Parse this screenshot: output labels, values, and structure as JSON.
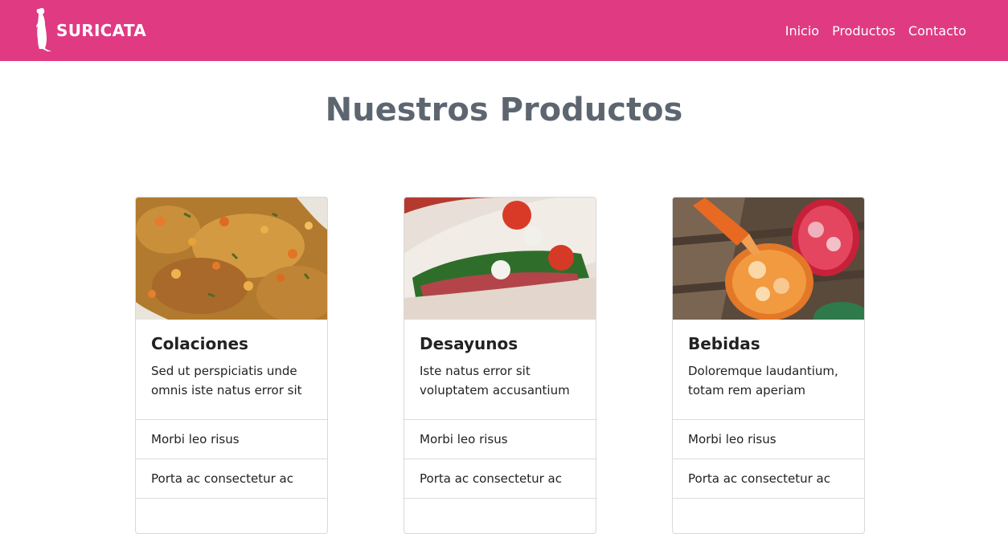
{
  "navbar": {
    "brand_name": "SURICATA",
    "brand_icon": "meerkat-icon",
    "links": [
      "Inicio",
      "Productos",
      "Contacto"
    ],
    "background": "#e03a82"
  },
  "page": {
    "title": "Nuestros Productos"
  },
  "cards": [
    {
      "title": "Colaciones",
      "text": "Sed ut perspiciatis unde omnis iste natus error sit",
      "image": "food-stew-image",
      "items": [
        "Morbi leo risus",
        "Porta ac consectetur ac",
        ""
      ]
    },
    {
      "title": "Desayunos",
      "text": "Iste natus error sit voluptatem accusantium",
      "image": "sandwich-image",
      "items": [
        "Morbi leo risus",
        "Porta ac consectetur ac",
        ""
      ]
    },
    {
      "title": "Bebidas",
      "text": "Doloremque laudantium, totam rem aperiam",
      "image": "drinks-image",
      "items": [
        "Morbi leo risus",
        "Porta ac consectetur ac",
        ""
      ]
    }
  ]
}
